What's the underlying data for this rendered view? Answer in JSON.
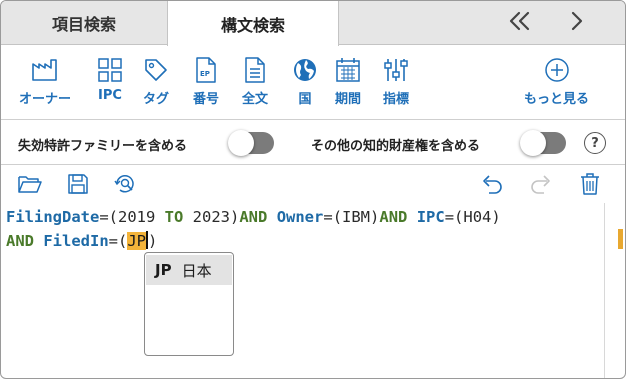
{
  "tabs": [
    {
      "label": "項目検索",
      "active": false
    },
    {
      "label": "構文検索",
      "active": true
    }
  ],
  "nav": {
    "prev_icon": "double-chevron-left-icon",
    "next_icon": "chevron-right-icon"
  },
  "toolbar": [
    {
      "label": "オーナー",
      "icon": "factory-icon"
    },
    {
      "label": "IPC",
      "icon": "grid-icon"
    },
    {
      "label": "タグ",
      "icon": "tag-icon"
    },
    {
      "label": "番号",
      "icon": "ep-document-icon"
    },
    {
      "label": "全文",
      "icon": "document-icon"
    },
    {
      "label": "国",
      "icon": "globe-icon"
    },
    {
      "label": "期間",
      "icon": "calendar-icon"
    },
    {
      "label": "指標",
      "icon": "sliders-icon"
    },
    {
      "label": "もっと見る",
      "icon": "plus-circle-icon"
    }
  ],
  "options": {
    "expired_family": {
      "label": "失効特許ファミリーを含める",
      "on": false
    },
    "other_ip": {
      "label": "その他の知的財産権を含める",
      "on": false
    },
    "help": "?"
  },
  "editor_tools": [
    "folder-open-icon",
    "save-icon",
    "history-search-icon",
    "undo-icon",
    "redo-icon",
    "trash-icon"
  ],
  "query": {
    "line1": [
      {
        "t": "FilingDate",
        "c": "kw"
      },
      {
        "t": "=(",
        "c": "val"
      },
      {
        "t": "2019 ",
        "c": "val"
      },
      {
        "t": "TO",
        "c": "op"
      },
      {
        "t": " 2023)",
        "c": "val"
      },
      {
        "t": "AND",
        "c": "op"
      },
      {
        "t": " ",
        "c": "val"
      },
      {
        "t": "Owner",
        "c": "kw"
      },
      {
        "t": "=(IBM)",
        "c": "val"
      },
      {
        "t": "AND",
        "c": "op"
      },
      {
        "t": " ",
        "c": "val"
      },
      {
        "t": "IPC",
        "c": "kw"
      },
      {
        "t": "=(H04)",
        "c": "val"
      }
    ],
    "line2_prefix_op": "AND",
    "line2_field": "FiledIn",
    "line2_open": "=(",
    "line2_selected": "JP",
    "line2_close": ")"
  },
  "autocomplete": [
    {
      "code": "JP",
      "name": "日本"
    }
  ]
}
